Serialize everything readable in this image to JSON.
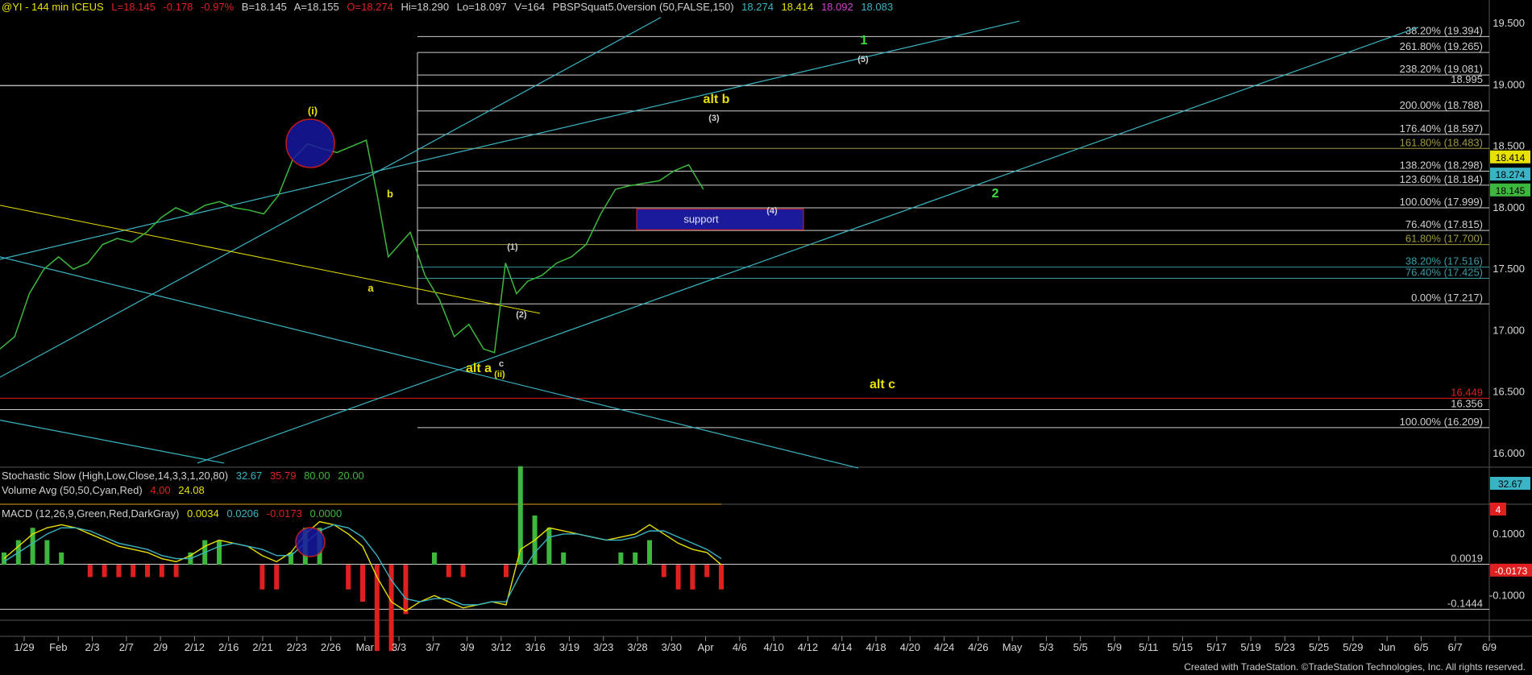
{
  "header": {
    "symbol": "@YI - 144 min  ICEUS",
    "last": "L=18.145",
    "change": "-0.178",
    "change_pct": "-0.97%",
    "bid": "B=18.145",
    "ask": "A=18.155",
    "open": "O=18.274",
    "hi": "Hi=18.290",
    "lo": "Lo=18.097",
    "vol": "V=164",
    "indicator": "PBSPSquat5.0version (50,FALSE,150)",
    "v1": "18.274",
    "v2": "18.414",
    "v3": "18.092",
    "v4": "18.083"
  },
  "stoch_header": {
    "label": "Stochastic Slow (High,Low,Close,14,3,3,1,20,80)",
    "k": "32.67",
    "d": "35.79",
    "ob": "80.00",
    "os": "20.00"
  },
  "volume_header": {
    "label": "Volume Avg (50,50,Cyan,Red)",
    "v1": "4.00",
    "v2": "24.08"
  },
  "macd_header": {
    "label": "MACD (12,26,9,Green,Red,DarkGray)",
    "macd": "0.0034",
    "signal": "0.0206",
    "hist": "-0.0173",
    "zero": "0.0000"
  },
  "footer": "Created with TradeStation. ©TradeStation Technologies, Inc. All rights reserved.",
  "colors": {
    "background": "#000000",
    "price": "#3cb83c",
    "cyan": "#3ab4c4",
    "white": "#d0d0d0",
    "yellow": "#e8e000",
    "olive": "#a09a40",
    "red": "#e02020",
    "green_label": "#3ce03c",
    "support_fill": "#1a1a9a",
    "axis_text": "#d8d8d8"
  },
  "chart_data": {
    "type": "line",
    "title": "@YI - 144 min ICEUS",
    "ylim": [
      15.9,
      19.6
    ],
    "y_ticks": [
      16.0,
      16.5,
      17.0,
      17.5,
      18.0,
      18.5,
      19.0,
      19.5
    ],
    "x_tick_labels": [
      "1/29",
      "Feb",
      "2/3",
      "2/7",
      "2/9",
      "2/12",
      "2/16",
      "2/21",
      "2/23",
      "2/26",
      "Mar",
      "3/3",
      "3/7",
      "3/9",
      "3/12",
      "3/16",
      "3/19",
      "3/23",
      "3/28",
      "3/30",
      "Apr",
      "4/6",
      "4/10",
      "4/12",
      "4/14",
      "4/18",
      "4/20",
      "4/24",
      "4/26",
      "May",
      "5/3",
      "5/5",
      "5/9",
      "5/11",
      "5/15",
      "5/17",
      "5/19",
      "5/23",
      "5/25",
      "5/29",
      "Jun",
      "6/5",
      "6/7",
      "6/9"
    ],
    "price_series": {
      "name": "@YI",
      "x": [
        0,
        4,
        8,
        12,
        16,
        20,
        24,
        28,
        32,
        36,
        40,
        44,
        48,
        52,
        56,
        60,
        64,
        68,
        72,
        76,
        80,
        84,
        88,
        92,
        96,
        100,
        103,
        106,
        109,
        112,
        116,
        120,
        124,
        128,
        132,
        135,
        138,
        141,
        144,
        148,
        152,
        156,
        160,
        164,
        168,
        172,
        176,
        180,
        184,
        188,
        192
      ],
      "y": [
        16.85,
        16.95,
        17.3,
        17.5,
        17.6,
        17.5,
        17.55,
        17.7,
        17.75,
        17.72,
        17.8,
        17.92,
        18.0,
        17.95,
        18.02,
        18.05,
        18.0,
        17.98,
        17.95,
        18.1,
        18.4,
        18.52,
        18.48,
        18.45,
        18.5,
        18.55,
        18.1,
        17.6,
        17.7,
        17.8,
        17.45,
        17.25,
        16.95,
        17.05,
        16.85,
        16.82,
        17.55,
        17.3,
        17.4,
        17.45,
        17.55,
        17.6,
        17.7,
        17.95,
        18.15,
        18.18,
        18.2,
        18.22,
        18.3,
        18.35,
        18.15
      ]
    },
    "fib_levels": [
      {
        "label": "38.20% (19.394)",
        "value": 19.394
      },
      {
        "label": "261.80% (19.265)",
        "value": 19.265
      },
      {
        "label": "238.20% (19.081)",
        "value": 19.081
      },
      {
        "label": "200.00% (18.788)",
        "value": 18.788
      },
      {
        "label": "176.40% (18.597)",
        "value": 18.597
      },
      {
        "label": "161.80% (18.483)",
        "value": 18.483
      },
      {
        "label": "138.20% (18.298)",
        "value": 18.298
      },
      {
        "label": "123.60% (18.184)",
        "value": 18.184
      },
      {
        "label": "100.00% (17.999)",
        "value": 17.999
      },
      {
        "label": "76.40% (17.815)",
        "value": 17.815
      },
      {
        "label": "61.80% (17.700)",
        "value": 17.7
      },
      {
        "label": "38.20% (17.516)",
        "value": 17.516
      },
      {
        "label": "76.40% (17.425)",
        "value": 17.425
      },
      {
        "label": "0.00% (17.217)",
        "value": 17.217
      },
      {
        "label": "100.00% (16.209)",
        "value": 16.209
      }
    ],
    "horizontal_levels": [
      {
        "label": "18.995",
        "value": 18.995
      },
      {
        "label": "16.449",
        "value": 16.449
      },
      {
        "label": "16.356",
        "value": 16.356
      }
    ],
    "axis_price_boxes": [
      {
        "label": "18.414",
        "value": 18.414
      },
      {
        "label": "18.274",
        "value": 18.274
      },
      {
        "label": "18.145",
        "value": 18.145
      }
    ],
    "wave_labels": [
      "(i)",
      "b",
      "a",
      "alt a",
      "c",
      "(ii)",
      "(1)",
      "(2)",
      "(3)",
      "(4)",
      "(5)",
      "alt b",
      "alt c",
      "1",
      "2"
    ],
    "support_box": {
      "label": "support",
      "y_top": 17.99,
      "y_bottom": 17.82
    },
    "stochastic": {
      "k": 32.67,
      "d": 35.79,
      "overbought": 80.0,
      "oversold": 20.0,
      "axis_box": "32.67",
      "red_box": "4"
    },
    "macd": {
      "y_ticks": [
        0.1,
        -0.1
      ],
      "y_tick_labels": [
        "0.1000",
        "-0.1000"
      ],
      "level_labels": [
        "0.0019",
        "-0.1444"
      ],
      "axis_box": "-0.0173",
      "macd_series": [
        0.02,
        0.06,
        0.1,
        0.12,
        0.13,
        0.12,
        0.1,
        0.08,
        0.06,
        0.05,
        0.04,
        0.02,
        0.01,
        0.03,
        0.06,
        0.08,
        0.07,
        0.06,
        0.03,
        0.01,
        0.04,
        0.1,
        0.14,
        0.13,
        0.1,
        0.06,
        -0.04,
        -0.12,
        -0.15,
        -0.12,
        -0.1,
        -0.12,
        -0.14,
        -0.13,
        -0.12,
        -0.13,
        0.05,
        0.08,
        0.12,
        0.11,
        0.1,
        0.09,
        0.08,
        0.09,
        0.1,
        0.13,
        0.1,
        0.07,
        0.05,
        0.04,
        0.0
      ],
      "signal_series": [
        0.01,
        0.04,
        0.07,
        0.1,
        0.12,
        0.12,
        0.11,
        0.09,
        0.07,
        0.06,
        0.05,
        0.03,
        0.02,
        0.02,
        0.04,
        0.06,
        0.07,
        0.06,
        0.05,
        0.03,
        0.03,
        0.07,
        0.11,
        0.13,
        0.12,
        0.09,
        0.03,
        -0.05,
        -0.11,
        -0.12,
        -0.11,
        -0.11,
        -0.13,
        -0.13,
        -0.12,
        -0.12,
        -0.03,
        0.04,
        0.09,
        0.1,
        0.1,
        0.09,
        0.08,
        0.08,
        0.09,
        0.11,
        0.11,
        0.09,
        0.07,
        0.05,
        0.02
      ]
    }
  }
}
